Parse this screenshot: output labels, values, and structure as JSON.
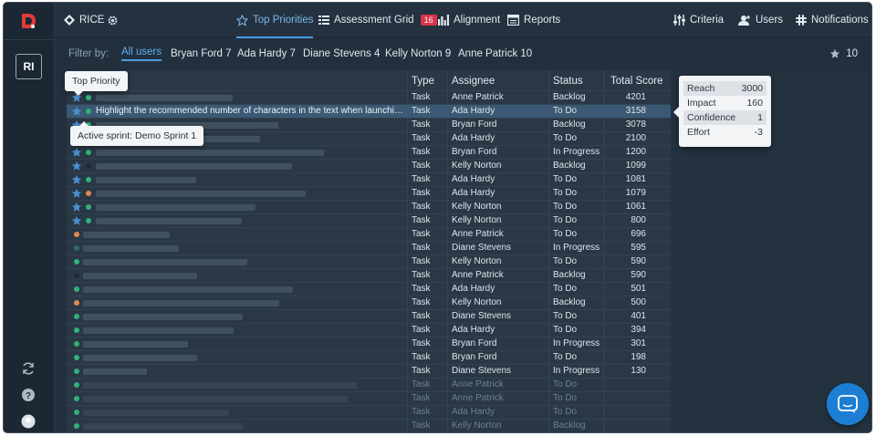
{
  "app": {
    "workspace_initials": "RI",
    "board_name": "RICE"
  },
  "nav": {
    "items": [
      {
        "label": "Top Priorities",
        "icon": "star-outline-icon",
        "active": true
      },
      {
        "label": "Assessment Grid",
        "icon": "grid-icon",
        "badge": "16"
      },
      {
        "label": "Alignment",
        "icon": "bar-chart-icon"
      },
      {
        "label": "Reports",
        "icon": "report-icon"
      }
    ],
    "right": [
      {
        "label": "Criteria",
        "icon": "sliders-icon"
      },
      {
        "label": "Users",
        "icon": "add-user-icon"
      },
      {
        "label": "Notifications",
        "icon": "slack-icon"
      }
    ]
  },
  "filter": {
    "label": "Filter by:",
    "options": [
      "All users",
      "Bryan Ford 7",
      "Ada Hardy 7",
      "Diane Stevens 4",
      "Kelly Norton 9",
      "Anne Patrick 10"
    ],
    "active_index": 0,
    "star_count": "10"
  },
  "table": {
    "columns": [
      "Type",
      "Assignee",
      "Status",
      "Total Score"
    ],
    "selected_title": "Highlight the recommended number of characters in the text when launching ...",
    "rows": [
      {
        "type": "Task",
        "assignee": "Anne Patrick",
        "status": "Backlog",
        "score": "4201",
        "star": true,
        "faded": false
      },
      {
        "type": "Task",
        "assignee": "Ada Hardy",
        "status": "To Do",
        "score": "3158",
        "star": true,
        "faded": false
      },
      {
        "type": "Task",
        "assignee": "Bryan Ford",
        "status": "Backlog",
        "score": "3078",
        "star": true,
        "faded": false
      },
      {
        "type": "Task",
        "assignee": "Ada Hardy",
        "status": "To Do",
        "score": "2100",
        "star": true,
        "faded": false
      },
      {
        "type": "Task",
        "assignee": "Bryan Ford",
        "status": "In Progress",
        "score": "1200",
        "star": true,
        "faded": false
      },
      {
        "type": "Task",
        "assignee": "Kelly Norton",
        "status": "Backlog",
        "score": "1099",
        "star": true,
        "faded": false
      },
      {
        "type": "Task",
        "assignee": "Ada Hardy",
        "status": "To Do",
        "score": "1081",
        "star": true,
        "faded": false
      },
      {
        "type": "Task",
        "assignee": "Ada Hardy",
        "status": "To Do",
        "score": "1079",
        "star": true,
        "faded": false
      },
      {
        "type": "Task",
        "assignee": "Kelly Norton",
        "status": "To Do",
        "score": "1061",
        "star": true,
        "faded": false
      },
      {
        "type": "Task",
        "assignee": "Kelly Norton",
        "status": "To Do",
        "score": "800",
        "star": true,
        "faded": false
      },
      {
        "type": "Task",
        "assignee": "Anne Patrick",
        "status": "To Do",
        "score": "696",
        "star": false,
        "faded": false
      },
      {
        "type": "Task",
        "assignee": "Diane Stevens",
        "status": "In Progress",
        "score": "595",
        "star": false,
        "faded": false
      },
      {
        "type": "Task",
        "assignee": "Kelly Norton",
        "status": "To Do",
        "score": "590",
        "star": false,
        "faded": false
      },
      {
        "type": "Task",
        "assignee": "Anne Patrick",
        "status": "Backlog",
        "score": "590",
        "star": false,
        "faded": false
      },
      {
        "type": "Task",
        "assignee": "Ada Hardy",
        "status": "To Do",
        "score": "501",
        "star": false,
        "faded": false
      },
      {
        "type": "Task",
        "assignee": "Kelly Norton",
        "status": "Backlog",
        "score": "500",
        "star": false,
        "faded": false
      },
      {
        "type": "Task",
        "assignee": "Diane Stevens",
        "status": "To Do",
        "score": "401",
        "star": false,
        "faded": false
      },
      {
        "type": "Task",
        "assignee": "Ada Hardy",
        "status": "To Do",
        "score": "394",
        "star": false,
        "faded": false
      },
      {
        "type": "Task",
        "assignee": "Bryan Ford",
        "status": "In Progress",
        "score": "301",
        "star": false,
        "faded": false
      },
      {
        "type": "Task",
        "assignee": "Bryan Ford",
        "status": "To Do",
        "score": "198",
        "star": false,
        "faded": false
      },
      {
        "type": "Task",
        "assignee": "Diane Stevens",
        "status": "In Progress",
        "score": "130",
        "star": false,
        "faded": false
      },
      {
        "type": "Task",
        "assignee": "Anne Patrick",
        "status": "To Do",
        "score": "",
        "star": false,
        "faded": true
      },
      {
        "type": "Task",
        "assignee": "Anne Patrick",
        "status": "To Do",
        "score": "",
        "star": false,
        "faded": true
      },
      {
        "type": "Task",
        "assignee": "Ada Hardy",
        "status": "To Do",
        "score": "",
        "star": false,
        "faded": true
      },
      {
        "type": "Task",
        "assignee": "Kelly Norton",
        "status": "Backlog",
        "score": "",
        "star": false,
        "faded": true
      }
    ]
  },
  "tooltips": {
    "top_priority": "Top Priority",
    "active_sprint": "Active sprint: Demo Sprint 1"
  },
  "rice_popover": {
    "items": [
      {
        "label": "Reach",
        "value": "3000"
      },
      {
        "label": "Impact",
        "value": "160"
      },
      {
        "label": "Confidence",
        "value": "1"
      },
      {
        "label": "Effort",
        "value": "-3"
      }
    ]
  },
  "colors": {
    "accent": "#4a9de0",
    "star": "#4a8fd0",
    "dot_green": "#2fb27a",
    "dot_orange": "#e0894f",
    "badge": "#d9334a",
    "selected_row": "#3b5974"
  }
}
